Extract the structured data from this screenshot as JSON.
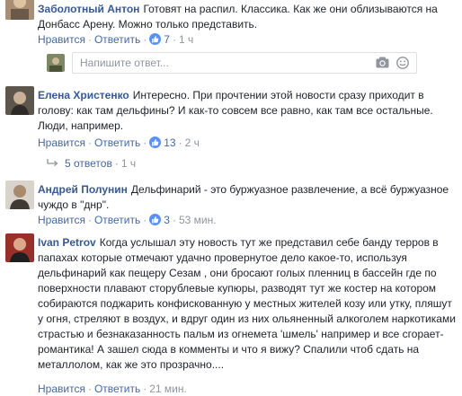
{
  "comments": [
    {
      "author": "Заболотный Антон",
      "text": "Готовят на распил. Классика. Как же они облизываются на Донбасс Арену. Можно только представить.",
      "like_label": "Нравится",
      "reply_label": "Ответить",
      "likes": "7",
      "time": "1 ч"
    },
    {
      "author": "Елена Христенко",
      "text": "Интересно. При прочтении этой новости сразу приходит в голову: как там дельфины? И как-то совсем все равно, как там все остальные. Люди, например.",
      "like_label": "Нравится",
      "reply_label": "Ответить",
      "likes": "13",
      "time": "2 ч"
    },
    {
      "author": "Андрей Полунин",
      "text": "Дельфинарий - это буржуазное развлечение, а всё буржуазное чуждо в \"днр\".",
      "like_label": "Нравится",
      "reply_label": "Ответить",
      "likes": "3",
      "time": "53 мин."
    },
    {
      "author": "Ivan Petrov",
      "text": "Когда услышал эту новость тут же представил себе банду терров в папахах которые отмечают удачно провернутое дело какое-то, используя дельфинарий как пещеру Сезам , они бросают голых пленниц в бассейн где по поверхности плавают сторублевые купюры, разводят тут же костер на котором собираются поджарить конфискованную у местных жителей козу или утку, пляшут у огня, стреляют в воздух, и вдруг один из них ольяненный алкоголем наркотиками страстью и безнаказанность пальм из огнемета 'шмель' например и все сгорает- романтика! А зашел сюда в комменты и что я вижу? Спалили чтоб сдать на металлолом, как же это прозрачно....",
      "like_label": "Нравится",
      "reply_label": "Ответить",
      "time": "21 мин."
    }
  ],
  "reply_box": {
    "placeholder": "Напишите ответ..."
  },
  "replies_toggle": {
    "label": "5 ответов",
    "time": "1 ч"
  },
  "colors": {
    "link": "#4267b2",
    "author": "#365899",
    "muted": "#90949c",
    "like_badge": "#5890ff"
  }
}
